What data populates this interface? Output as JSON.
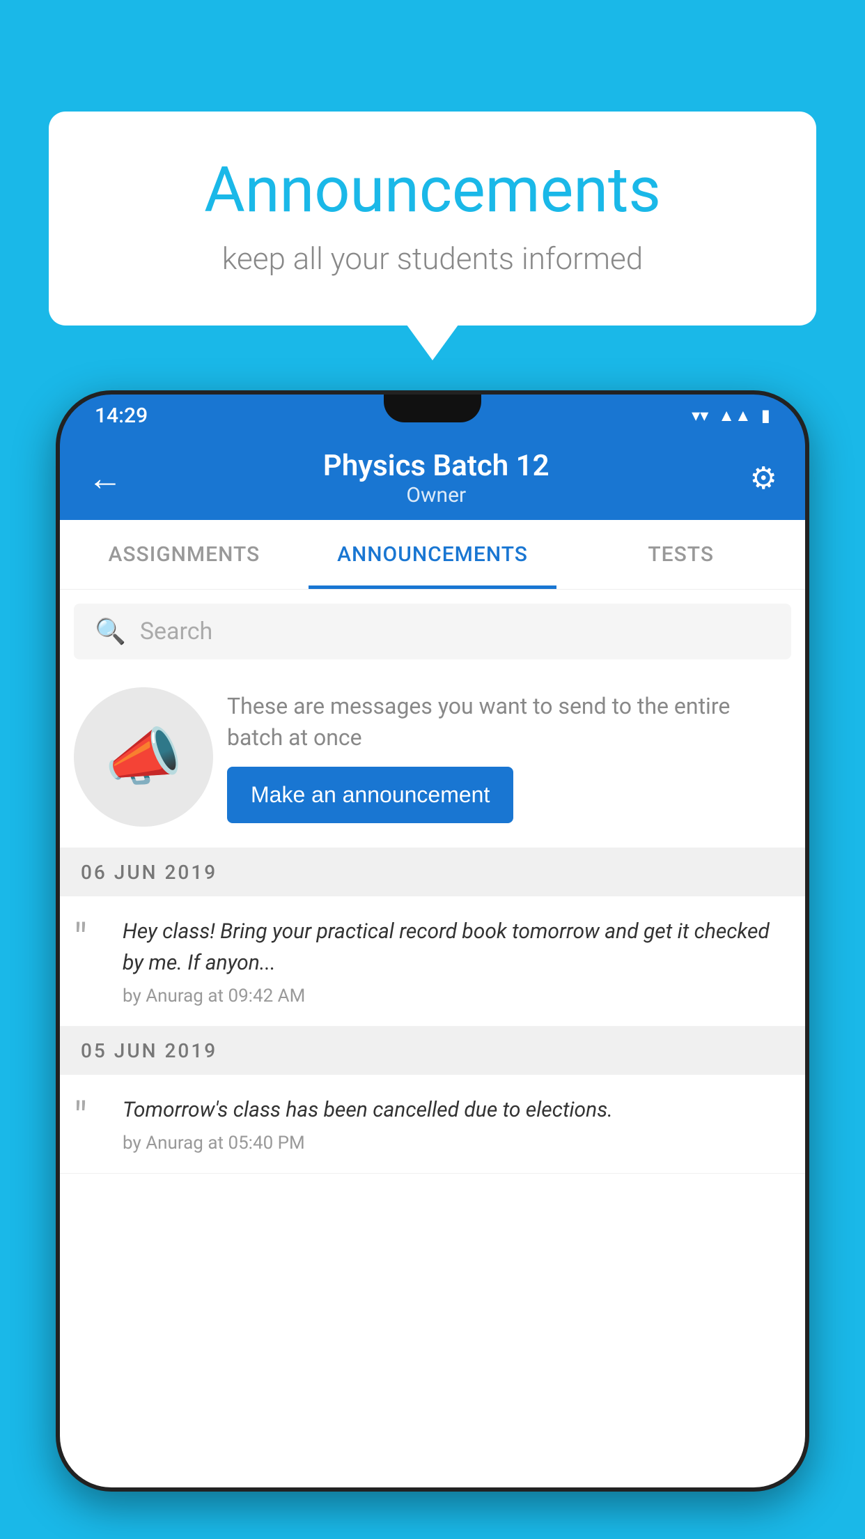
{
  "background_color": "#1AB8E8",
  "speech_bubble": {
    "title": "Announcements",
    "subtitle": "keep all your students informed"
  },
  "phone": {
    "status_bar": {
      "time": "14:29",
      "icons": [
        "wifi",
        "signal",
        "battery"
      ]
    },
    "app_bar": {
      "title": "Physics Batch 12",
      "subtitle": "Owner",
      "back_icon": "←",
      "settings_icon": "⚙"
    },
    "tabs": [
      {
        "label": "ASSIGNMENTS",
        "active": false
      },
      {
        "label": "ANNOUNCEMENTS",
        "active": true
      },
      {
        "label": "TESTS",
        "active": false
      }
    ],
    "search": {
      "placeholder": "Search"
    },
    "promo": {
      "description": "These are messages you want to send to the entire batch at once",
      "button_label": "Make an announcement"
    },
    "announcements": [
      {
        "date": "06  JUN  2019",
        "items": [
          {
            "text": "Hey class! Bring your practical record book tomorrow and get it checked by me. If anyon...",
            "meta": "by Anurag at 09:42 AM"
          }
        ]
      },
      {
        "date": "05  JUN  2019",
        "items": [
          {
            "text": "Tomorrow's class has been cancelled due to elections.",
            "meta": "by Anurag at 05:40 PM"
          }
        ]
      }
    ]
  }
}
